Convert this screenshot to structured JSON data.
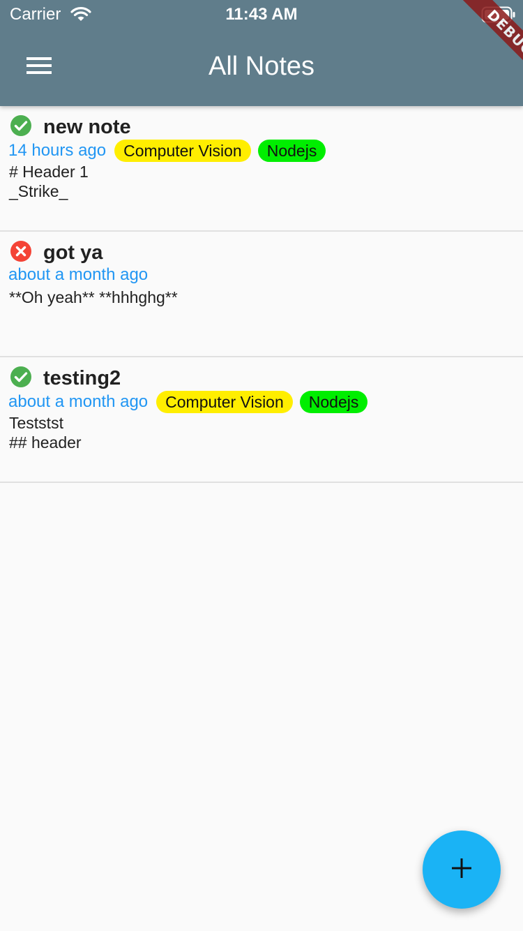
{
  "status_bar": {
    "carrier": "Carrier",
    "time": "11:43 AM"
  },
  "debug_banner": "DEBUG",
  "app_bar": {
    "title": "All Notes",
    "menu_icon": "hamburger-menu-icon"
  },
  "notes": [
    {
      "title": "new note",
      "status": "done",
      "status_icon": "check-circle-icon",
      "status_color": "#4caf50",
      "time": "14 hours ago",
      "tags": [
        {
          "label": "Computer Vision",
          "color": "#ffee00"
        },
        {
          "label": "Nodejs",
          "color": "#00ee00"
        }
      ],
      "body": "# Header 1\n_Strike_"
    },
    {
      "title": "got ya",
      "status": "not-done",
      "status_icon": "x-circle-icon",
      "status_color": "#f44336",
      "time": "about a month ago",
      "tags": [],
      "body": "**Oh yeah** **hhhghg**"
    },
    {
      "title": "testing2",
      "status": "done",
      "status_icon": "check-circle-icon",
      "status_color": "#4caf50",
      "time": "about a month ago",
      "tags": [
        {
          "label": "Computer Vision",
          "color": "#ffee00"
        },
        {
          "label": "Nodejs",
          "color": "#00ee00"
        }
      ],
      "body": "Teststst\n## header"
    }
  ],
  "fab": {
    "icon": "plus-icon",
    "color": "#1ab3f5"
  },
  "colors": {
    "app_bar": "#607d8b",
    "timestamp": "#2196f3",
    "background": "#fafafa"
  }
}
